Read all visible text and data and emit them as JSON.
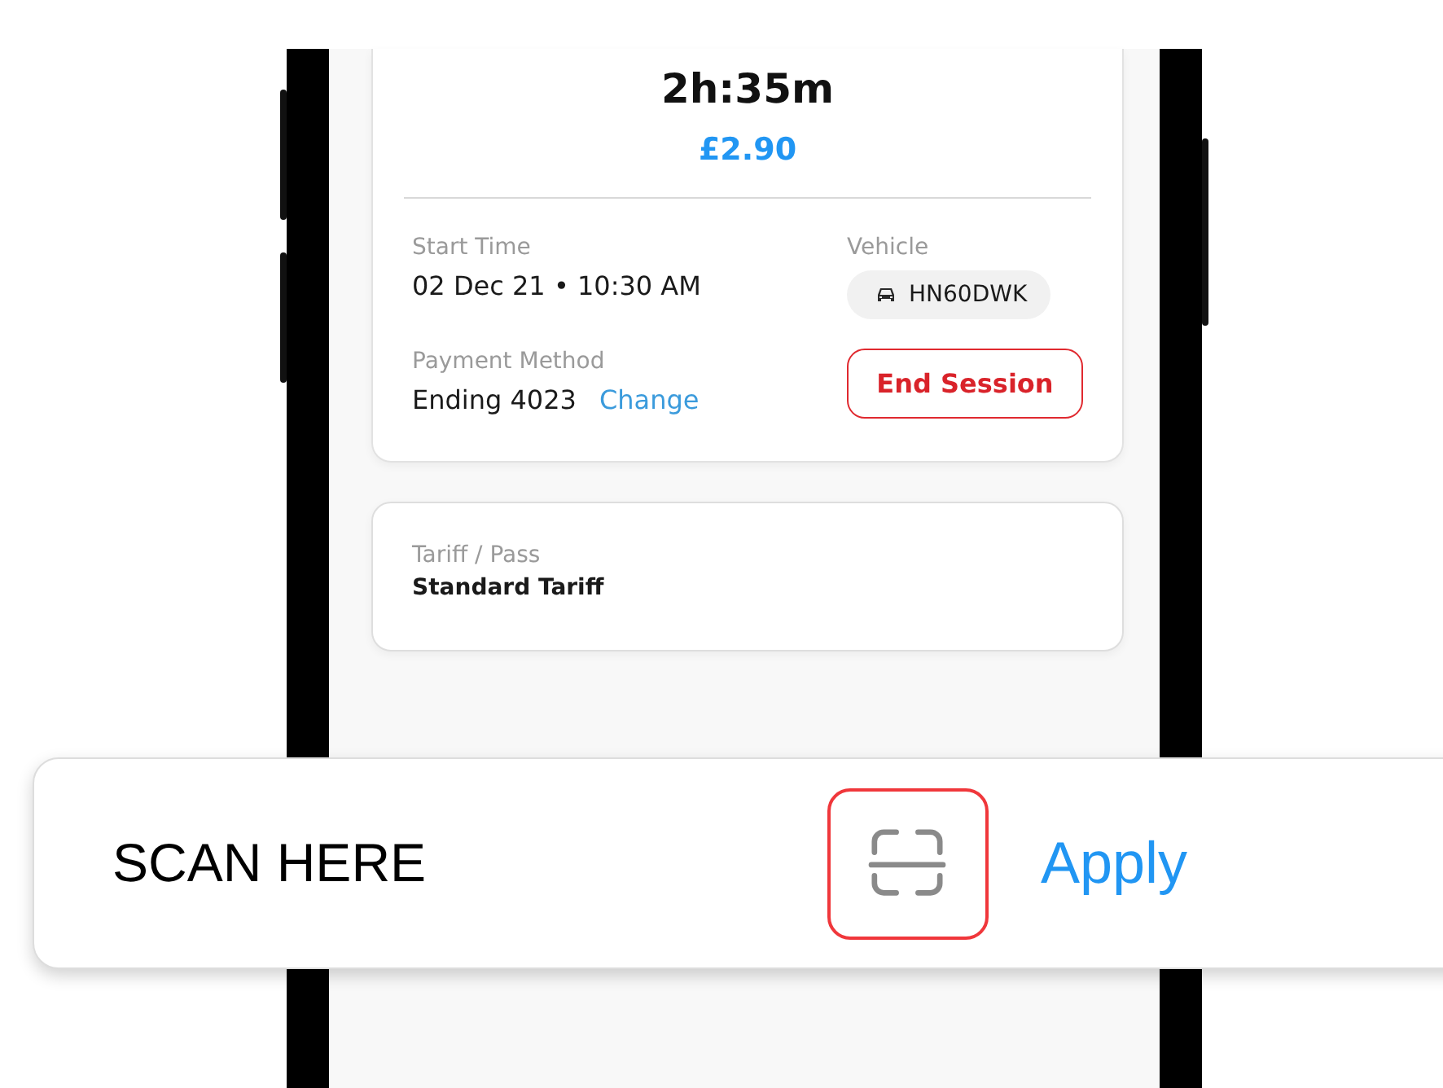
{
  "session": {
    "duration": "2h:35m",
    "cost": "£2.90",
    "start_time": {
      "label": "Start Time",
      "value": "02 Dec 21 • 10:30 AM"
    },
    "vehicle": {
      "label": "Vehicle",
      "plate": "HN60DWK"
    },
    "payment_method": {
      "label": "Payment Method",
      "value": "Ending 4023",
      "change_link": "Change"
    },
    "end_button": "End Session"
  },
  "tariff": {
    "label": "Tariff / Pass",
    "value": "Standard Tariff"
  },
  "scan_bar": {
    "label": "SCAN HERE",
    "apply": "Apply"
  }
}
